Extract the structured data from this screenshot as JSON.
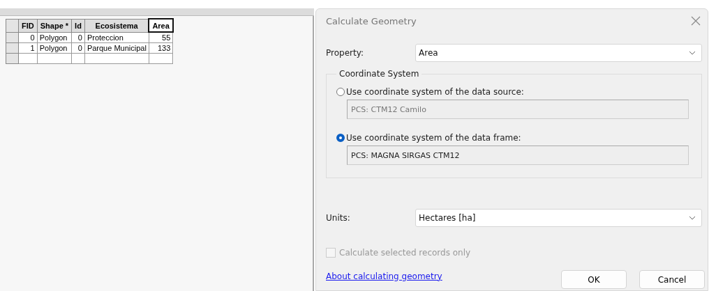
{
  "table": {
    "columns": [
      {
        "label": "FID",
        "kind": "number",
        "selected": false
      },
      {
        "label": "Shape *",
        "kind": "text",
        "selected": false
      },
      {
        "label": "Id",
        "kind": "number",
        "selected": false
      },
      {
        "label": "Ecosistema",
        "kind": "text",
        "selected": false
      },
      {
        "label": "Area",
        "kind": "number",
        "selected": true
      }
    ],
    "rows": [
      [
        "0",
        "Polygon",
        "0",
        "Proteccion",
        "55"
      ],
      [
        "1",
        "Polygon",
        "0",
        "Parque Municipal",
        "133"
      ]
    ]
  },
  "dialog": {
    "title": "Calculate Geometry",
    "property": {
      "label": "Property:",
      "value": "Area"
    },
    "group": {
      "title": "Coordinate System",
      "options": [
        {
          "label": "Use coordinate system of the data source:",
          "value": "PCS: CTM12 Camilo",
          "selected": false
        },
        {
          "label": "Use coordinate system of the data frame:",
          "value": "PCS: MAGNA SIRGAS CTM12",
          "selected": true
        }
      ]
    },
    "units": {
      "label": "Units:",
      "value": "Hectares [ha]"
    },
    "checkbox": {
      "label": "Calculate selected records only",
      "checked": false,
      "disabled": true
    },
    "link": "About calculating geometry",
    "buttons": [
      "OK",
      "Cancel"
    ]
  }
}
